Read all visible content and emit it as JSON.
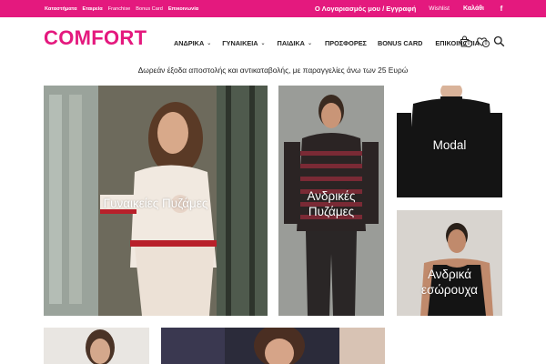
{
  "topbar": {
    "links": [
      "Καταστήματα",
      "Εταιρεία",
      "Franchise",
      "Bonus Card",
      "Επικοινωνία"
    ],
    "account": "Ο Λογαριασμός μου / Εγγραφή",
    "wishlist": "Wishlist",
    "cart": "Καλάθι",
    "social": "f"
  },
  "header": {
    "logo": "COMFORT",
    "nav": [
      "ΑΝΔΡΙΚΑ",
      "ΓΥΝΑΙΚΕΙΑ",
      "ΠΑΙΔΙΚΑ",
      "ΠΡΟΣΦΟΡΕΣ",
      "BONUS CARD",
      "ΕΠΙΚΟΙΝΩΝΙΑ"
    ],
    "wishlist_count": "0",
    "cart_count": "0"
  },
  "promo": "Δωρεάν έξοδα αποστολής και αντικαταβολής, με παραγγελίες άνω των 25 Ευρώ",
  "tiles": {
    "womens_pajamas": "Γυναικείες Πυζάμες",
    "mens_pajamas_line1": "Ανδρικές",
    "mens_pajamas_line2": "Πυζάμες",
    "modal": "Modal",
    "mens_underwear_line1": "Ανδρικά",
    "mens_underwear_line2": "εσώρουχα"
  },
  "colors": {
    "brand": "#e4197e",
    "text": "#222222"
  },
  "icons": [
    "facebook-icon",
    "bag-icon",
    "heart-icon",
    "search-icon",
    "chevron-down-icon"
  ]
}
